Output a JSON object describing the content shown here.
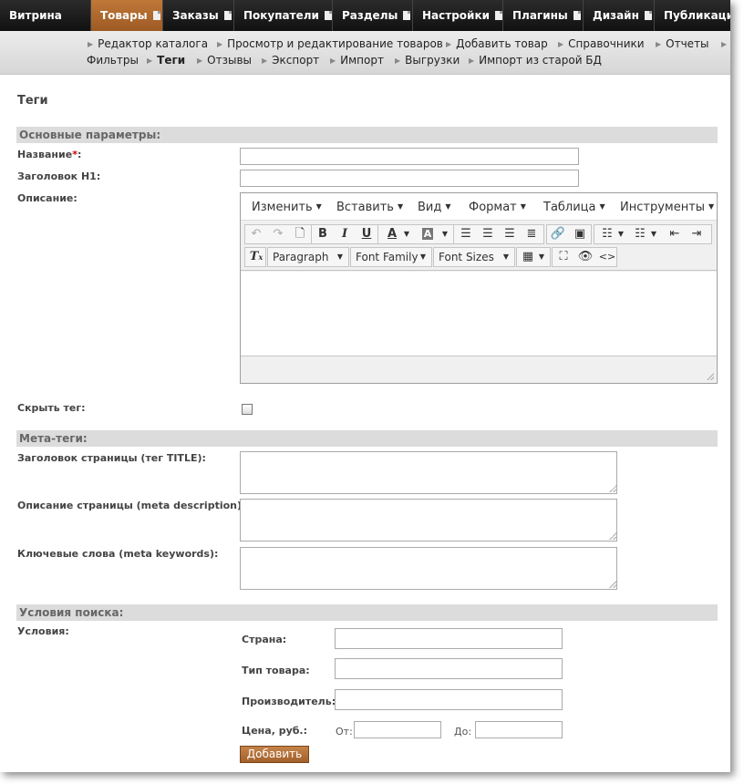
{
  "topnav": {
    "tabs": [
      {
        "label": "Витрина",
        "doc": false,
        "active": false
      },
      {
        "label": "Товары",
        "doc": true,
        "active": true
      },
      {
        "label": "Заказы",
        "doc": true,
        "active": false
      },
      {
        "label": "Покупатели",
        "doc": true,
        "active": false
      },
      {
        "label": "Разделы",
        "doc": true,
        "active": false
      },
      {
        "label": "Настройки",
        "doc": true,
        "active": false
      },
      {
        "label": "Плагины",
        "doc": true,
        "active": false
      },
      {
        "label": "Дизайн",
        "doc": true,
        "active": false
      },
      {
        "label": "Публикация",
        "doc": false,
        "active": false
      }
    ]
  },
  "subnav": {
    "row1": [
      "Редактор каталога",
      "Просмотр и редактирование товаров",
      "Добавить товар",
      "Справочники",
      "Отчеты"
    ],
    "row2": [
      "Фильтры",
      "Теги",
      "Отзывы",
      "Экспорт",
      "Импорт",
      "Выгрузки",
      "Импорт из старой БД"
    ],
    "active": "Теги"
  },
  "page": {
    "title": "Теги"
  },
  "basic": {
    "section": "Основные параметры:",
    "name_label": "Название",
    "name_required": "*",
    "name_colon": ":",
    "h1_label": "Заголовок H1:",
    "desc_label": "Описание:",
    "hide_label": "Скрыть тег:"
  },
  "editor": {
    "menus": [
      "Изменить",
      "Вставить",
      "Вид",
      "Формат",
      "Таблица",
      "Инструменты"
    ],
    "paragraph": "Paragraph",
    "font_family": "Font Family",
    "font_sizes": "Font Sizes"
  },
  "meta": {
    "section": "Мета-теги:",
    "title_label": "Заголовок страницы (тег TITLE):",
    "description_label": "Описание страницы (meta description):",
    "keywords_label": "Ключевые слова (meta keywords):"
  },
  "search": {
    "section": "Условия поиска:",
    "conditions_label": "Условия:",
    "country_label": "Страна:",
    "type_label": "Тип товара:",
    "maker_label": "Производитель:",
    "price_label": "Цена, руб.:",
    "from_label": "От:",
    "to_label": "До:",
    "add_button": "Добавить"
  },
  "colors": {
    "accent": "#b06a30",
    "topbar": "#1a1a1a"
  }
}
